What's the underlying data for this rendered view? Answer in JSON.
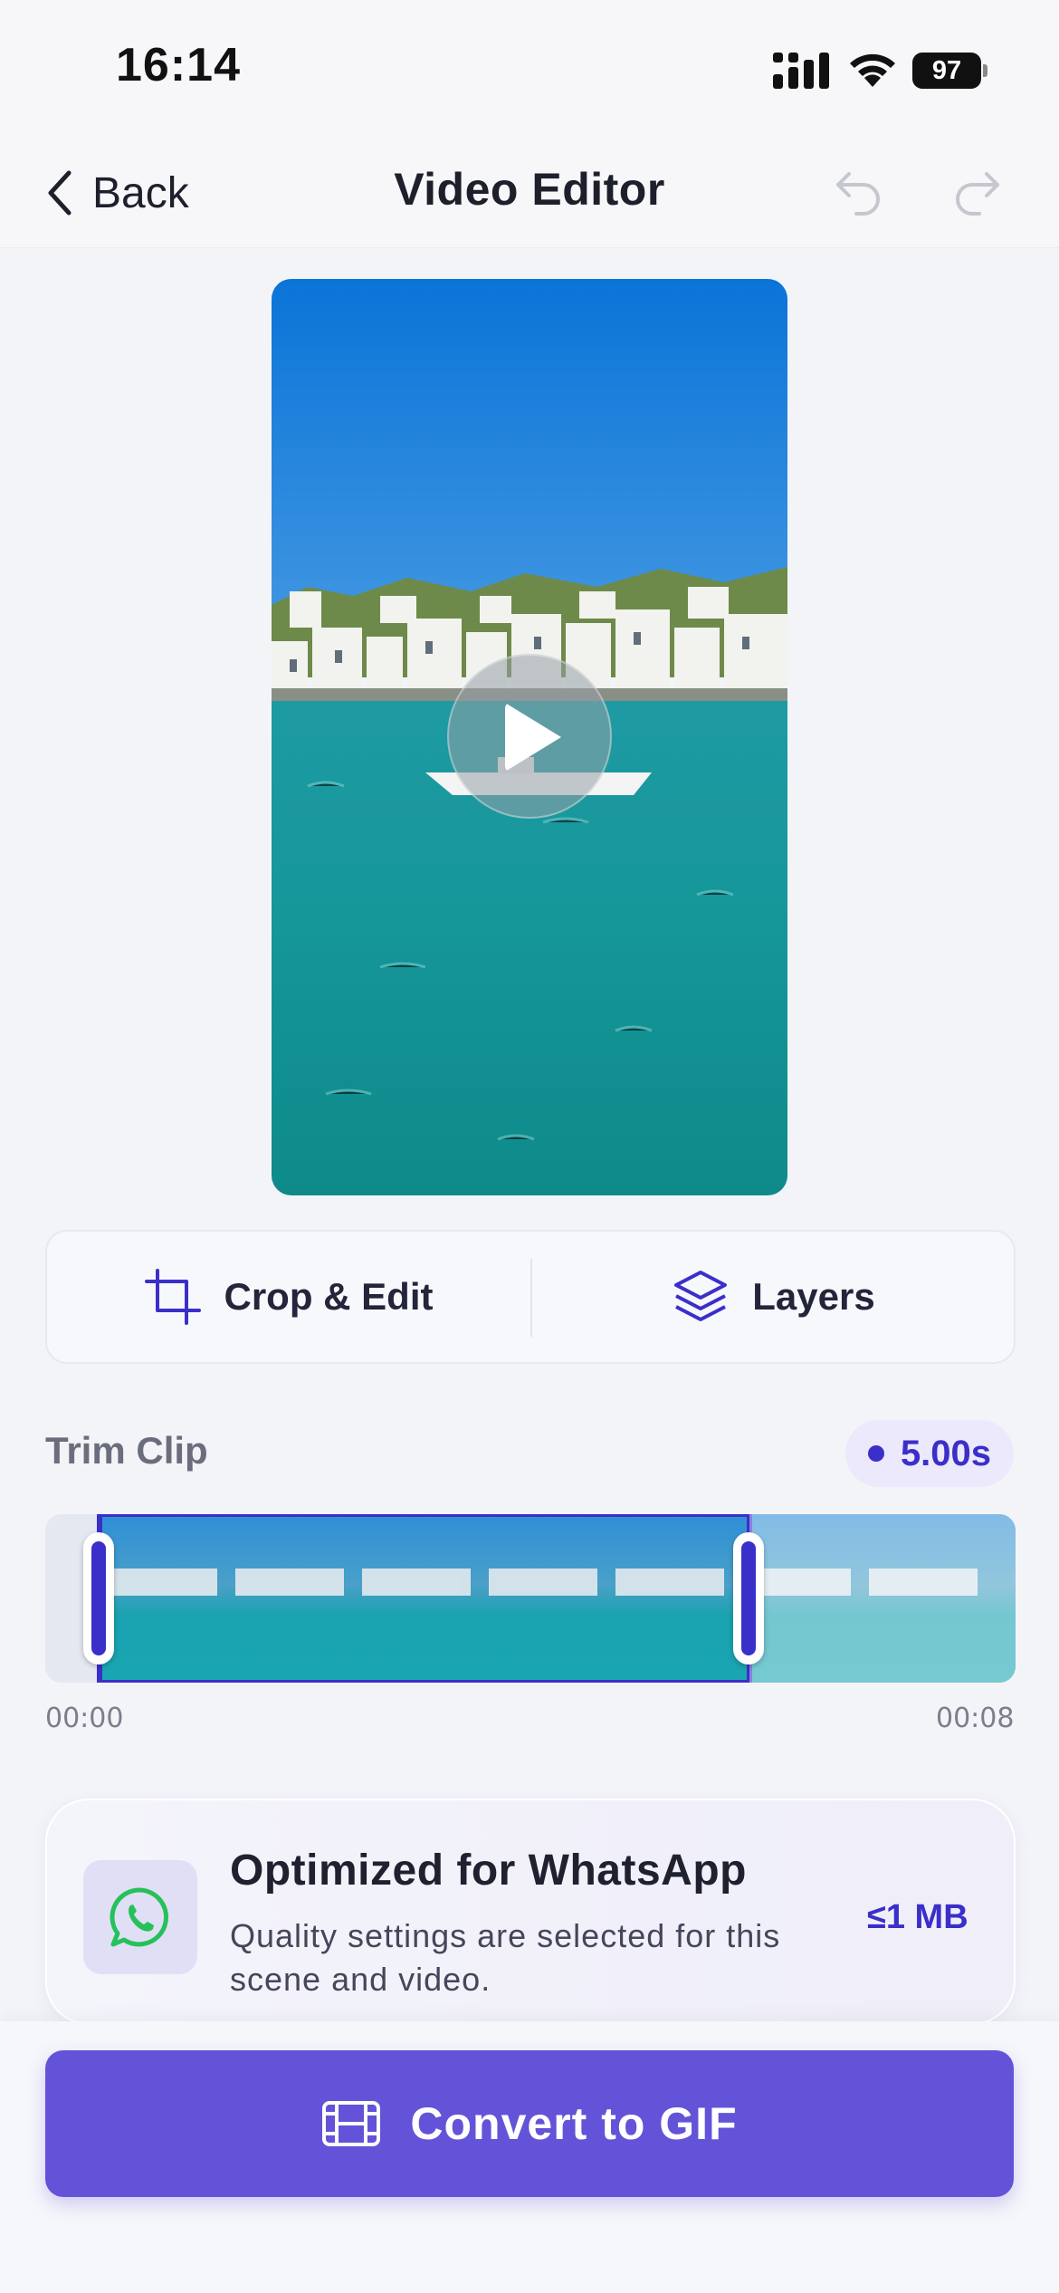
{
  "status_bar": {
    "time": "16:14",
    "battery": "97"
  },
  "nav": {
    "back_label": "Back",
    "title": "Video Editor"
  },
  "tools": {
    "crop_label": "Crop & Edit",
    "layers_label": "Layers"
  },
  "trim": {
    "title": "Trim Clip",
    "duration": "5.00s",
    "start_time": "00:00",
    "end_time": "00:08",
    "selection_start_fraction": 0.06,
    "selection_end_fraction": 0.725
  },
  "optimization": {
    "title": "Optimized for WhatsApp",
    "description": "Quality settings are selected for this scene and video.",
    "size_limit": "≤1 MB"
  },
  "convert": {
    "label": "Convert to GIF"
  },
  "colors": {
    "accent": "#3b2fc9",
    "button": "#6353d8",
    "whatsapp": "#25c15a"
  }
}
